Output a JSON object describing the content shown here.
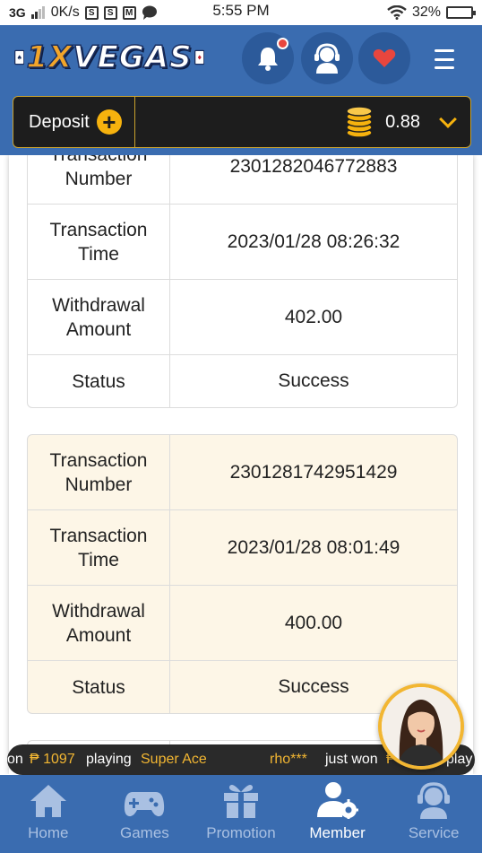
{
  "status_bar": {
    "network": "3G",
    "speed": "0K/s",
    "time": "5:55 PM",
    "battery": "32%"
  },
  "header": {
    "logo_prefix": "1X",
    "logo_suffix": "VEGAS"
  },
  "deposit_bar": {
    "deposit_label": "Deposit",
    "balance": "0.88"
  },
  "records": [
    {
      "rows": [
        {
          "label": "Transaction Number",
          "value": "2301282046772883"
        },
        {
          "label": "Transaction Time",
          "value": "2023/01/28 08:26:32"
        },
        {
          "label": "Withdrawal Amount",
          "value": "402.00"
        },
        {
          "label": "Status",
          "value": "Success"
        }
      ]
    },
    {
      "rows": [
        {
          "label": "Transaction Number",
          "value": "2301281742951429"
        },
        {
          "label": "Transaction Time",
          "value": "2023/01/28 08:01:49"
        },
        {
          "label": "Withdrawal Amount",
          "value": "400.00"
        },
        {
          "label": "Status",
          "value": "Success"
        }
      ]
    }
  ],
  "ticker": {
    "prefix": "on",
    "amount": "₱ 1097",
    "playing": "playing",
    "game": "Super Ace",
    "user": "rho***",
    "just_won": "just won",
    "currency": "₱",
    "tail": "play"
  },
  "bottom_nav": [
    {
      "label": "Home",
      "icon": "home-icon"
    },
    {
      "label": "Games",
      "icon": "gamepad-icon"
    },
    {
      "label": "Promotion",
      "icon": "gift-icon"
    },
    {
      "label": "Member",
      "icon": "member-settings-icon"
    },
    {
      "label": "Service",
      "icon": "headset-icon"
    }
  ],
  "colors": {
    "header_blue": "#3a6cb0",
    "gold": "#f2b632",
    "cream_card": "#fdf6e7",
    "notification_red": "#e8463e"
  }
}
